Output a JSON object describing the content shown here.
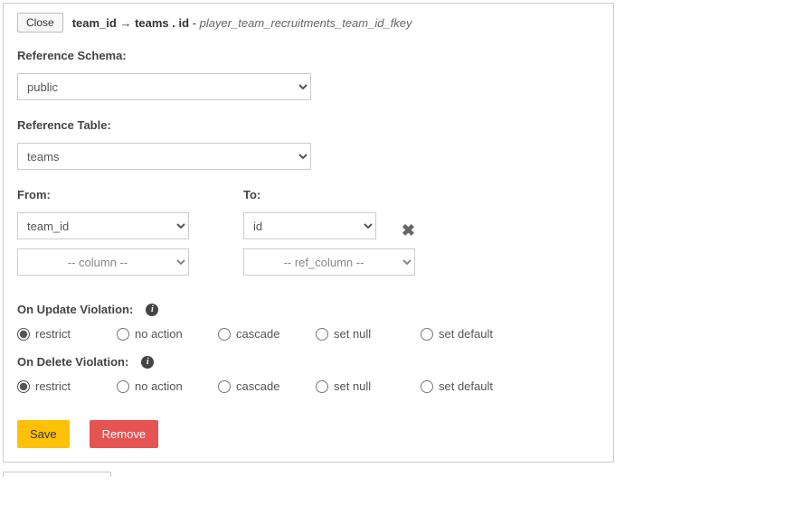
{
  "header": {
    "close_label": "Close",
    "fk_from_col": "team_id",
    "arrow": "→",
    "fk_to_table": "teams",
    "fk_to_col": "id",
    "constraint_name": "player_team_recruitments_team_id_fkey"
  },
  "reference_schema": {
    "label": "Reference Schema:",
    "value": "public"
  },
  "reference_table": {
    "label": "Reference Table:",
    "value": "teams"
  },
  "from_label": "From:",
  "to_label": "To:",
  "from_col_value": "team_id",
  "to_col_value": "id",
  "from_col_placeholder": "-- column --",
  "to_col_placeholder": "-- ref_column --",
  "on_update": {
    "label": "On Update Violation:",
    "selected": "restrict"
  },
  "on_delete": {
    "label": "On Delete Violation:",
    "selected": "restrict"
  },
  "violation_options": [
    {
      "value": "restrict",
      "label": "restrict"
    },
    {
      "value": "no_action",
      "label": "no action"
    },
    {
      "value": "cascade",
      "label": "cascade"
    },
    {
      "value": "set_null",
      "label": "set null"
    },
    {
      "value": "set_default",
      "label": "set default"
    }
  ],
  "buttons": {
    "save": "Save",
    "remove": "Remove"
  },
  "info_glyph": "i"
}
